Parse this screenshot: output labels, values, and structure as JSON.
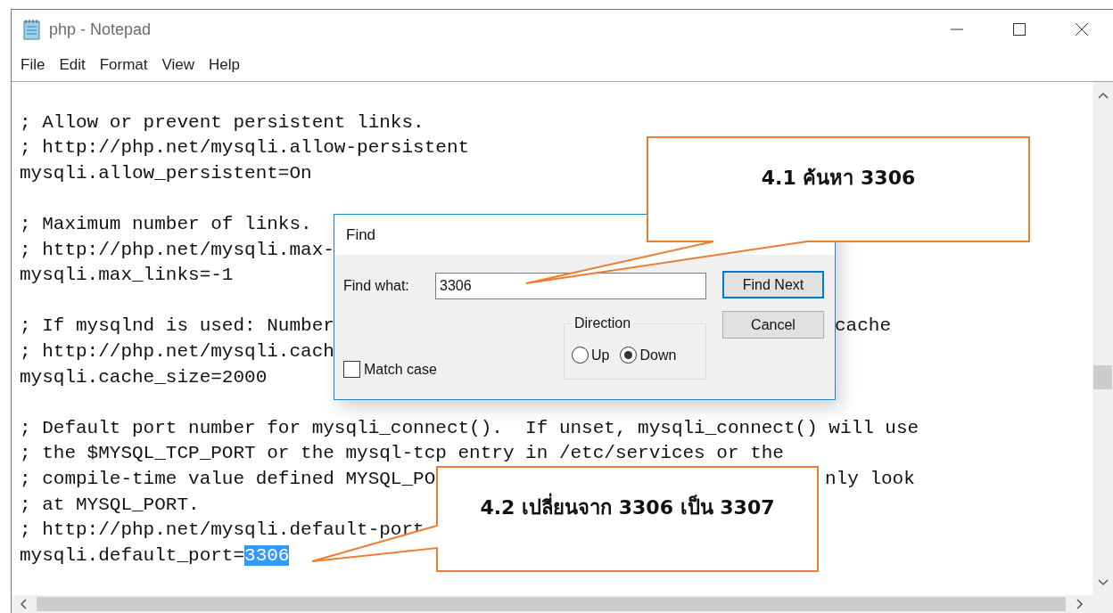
{
  "window": {
    "title": "php - Notepad"
  },
  "menu": [
    "File",
    "Edit",
    "Format",
    "View",
    "Help"
  ],
  "editor": {
    "blocks": [
      [
        {
          "text": "; Allow or prevent persistent links."
        },
        {
          "text": "; http://php.net/mysqli.allow-persistent"
        },
        {
          "text": "mysqli.allow_persistent=On"
        }
      ],
      [
        {
          "text": "; Maximum number of links."
        },
        {
          "text": "; http://php.net/mysqli.max-"
        },
        {
          "text": "mysqli.max_links=-1"
        }
      ],
      [
        {
          "text": "; If mysqlnd is used: Number",
          "right": "cache"
        },
        {
          "text": "; http://php.net/mysqli.cach"
        },
        {
          "text": "mysqli.cache_size=2000"
        }
      ],
      [
        {
          "text": "; Default port number for mysqli_connect().  If unset, mysqli_connect() will use"
        },
        {
          "text": "; the $MYSQL_TCP_PORT or the mysql-tcp entry in /etc/services or the"
        },
        {
          "text": "; compile-time value defined MYSQL_PO",
          "right": "nly look"
        },
        {
          "text": "; at MYSQL_PORT."
        },
        {
          "text": "; http://php.net/mysqli.default-port"
        },
        {
          "text": "mysqli.default_port=",
          "selection": "3306"
        }
      ]
    ]
  },
  "find_dialog": {
    "title": "Find",
    "find_what_label": "Find what:",
    "find_what_value": "3306",
    "buttons": [
      {
        "label": "Find Next",
        "default": true
      },
      {
        "label": "Cancel",
        "default": false
      }
    ],
    "direction": {
      "label": "Direction",
      "options": [
        {
          "label": "Up",
          "selected": false
        },
        {
          "label": "Down",
          "selected": true
        }
      ]
    },
    "match_case": {
      "label": "Match case",
      "checked": false
    }
  },
  "callouts": [
    {
      "text": "4.1 ค้นหา 3306"
    },
    {
      "text": "4.2 เปลี่ยนจาก 3306 เป็น 3307"
    }
  ]
}
